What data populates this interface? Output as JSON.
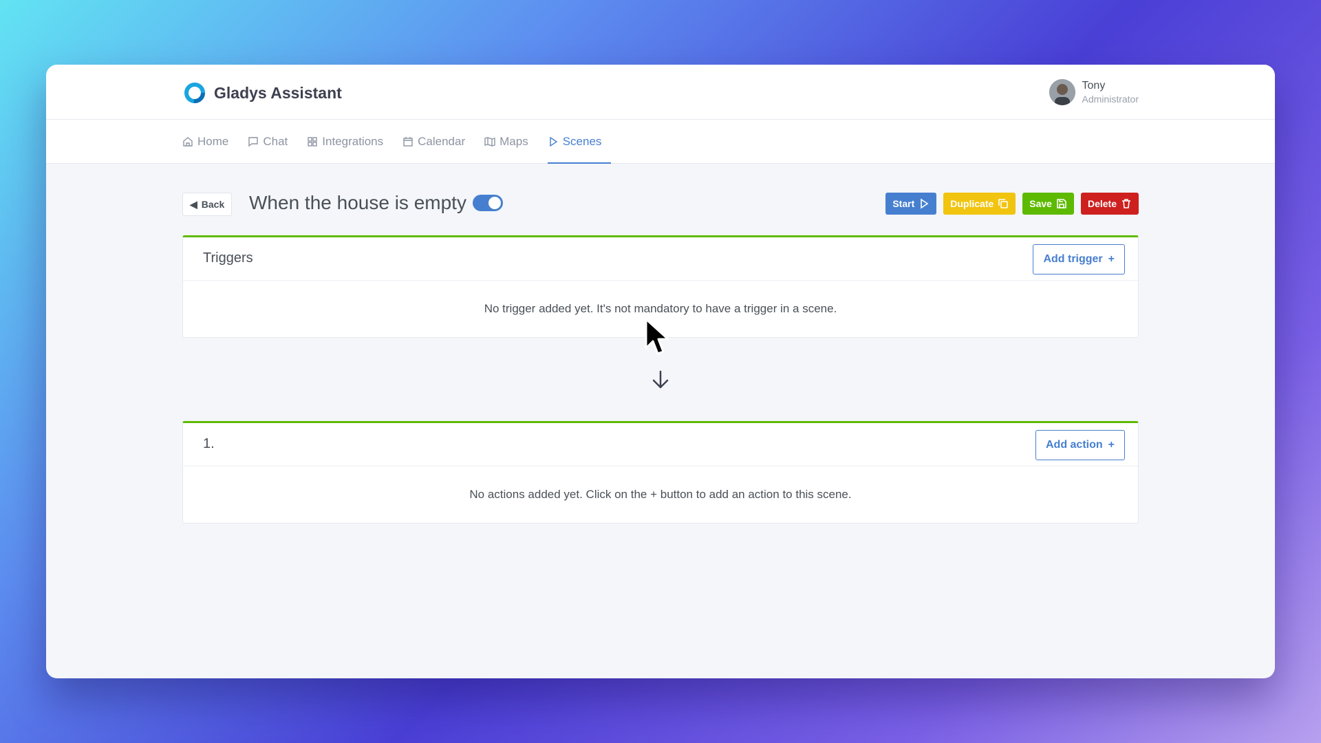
{
  "app": {
    "brand": "Gladys Assistant"
  },
  "user": {
    "name": "Tony",
    "role": "Administrator"
  },
  "nav": {
    "items": [
      {
        "label": "Home",
        "icon": "home-icon"
      },
      {
        "label": "Chat",
        "icon": "chat-icon"
      },
      {
        "label": "Integrations",
        "icon": "grid-icon"
      },
      {
        "label": "Calendar",
        "icon": "calendar-icon"
      },
      {
        "label": "Maps",
        "icon": "map-icon"
      },
      {
        "label": "Scenes",
        "icon": "play-icon",
        "active": true
      }
    ]
  },
  "scene": {
    "back_label": "Back",
    "title": "When the house is empty",
    "enabled": true,
    "buttons": {
      "start": "Start",
      "duplicate": "Duplicate",
      "save": "Save",
      "delete": "Delete"
    }
  },
  "triggers": {
    "title": "Triggers",
    "add_label": "Add trigger",
    "empty_text": "No trigger added yet. It's not mandatory to have a trigger in a scene."
  },
  "actions": {
    "title": "1.",
    "add_label": "Add action",
    "empty_text": "No actions added yet. Click on the + button to add an action to this scene."
  },
  "colors": {
    "primary": "#467fcf",
    "warning": "#f1c40f",
    "success": "#5eba00",
    "danger": "#cd201f"
  }
}
